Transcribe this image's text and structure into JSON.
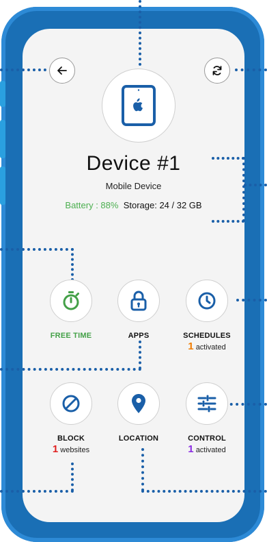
{
  "device": {
    "title": "Device #1",
    "type": "Mobile Device",
    "battery_label": "Battery : 88%",
    "storage_label": "Storage: 24 / 32 GB"
  },
  "colors": {
    "phone_frame": "#1a6fb5",
    "accent_blue": "#1a5fa8",
    "battery_green": "#4caf50",
    "free_time_green": "#43a047",
    "schedules_orange": "#f07c00",
    "block_red": "#e02020",
    "control_purple": "#8a2be2"
  },
  "features": [
    {
      "id": "free-time",
      "icon": "stopwatch-icon",
      "label": "FREE TIME",
      "count": "",
      "sub": ""
    },
    {
      "id": "apps",
      "icon": "lock-icon",
      "label": "APPS",
      "count": "",
      "sub": ""
    },
    {
      "id": "schedules",
      "icon": "clock-icon",
      "label": "SCHEDULES",
      "count": "1",
      "sub": "activated"
    },
    {
      "id": "block",
      "icon": "block-icon",
      "label": "BLOCK",
      "count": "1",
      "sub": "websites"
    },
    {
      "id": "location",
      "icon": "location-pin-icon",
      "label": "LOCATION",
      "count": "",
      "sub": ""
    },
    {
      "id": "control",
      "icon": "sliders-icon",
      "label": "CONTROL",
      "count": "1",
      "sub": "activated"
    }
  ]
}
